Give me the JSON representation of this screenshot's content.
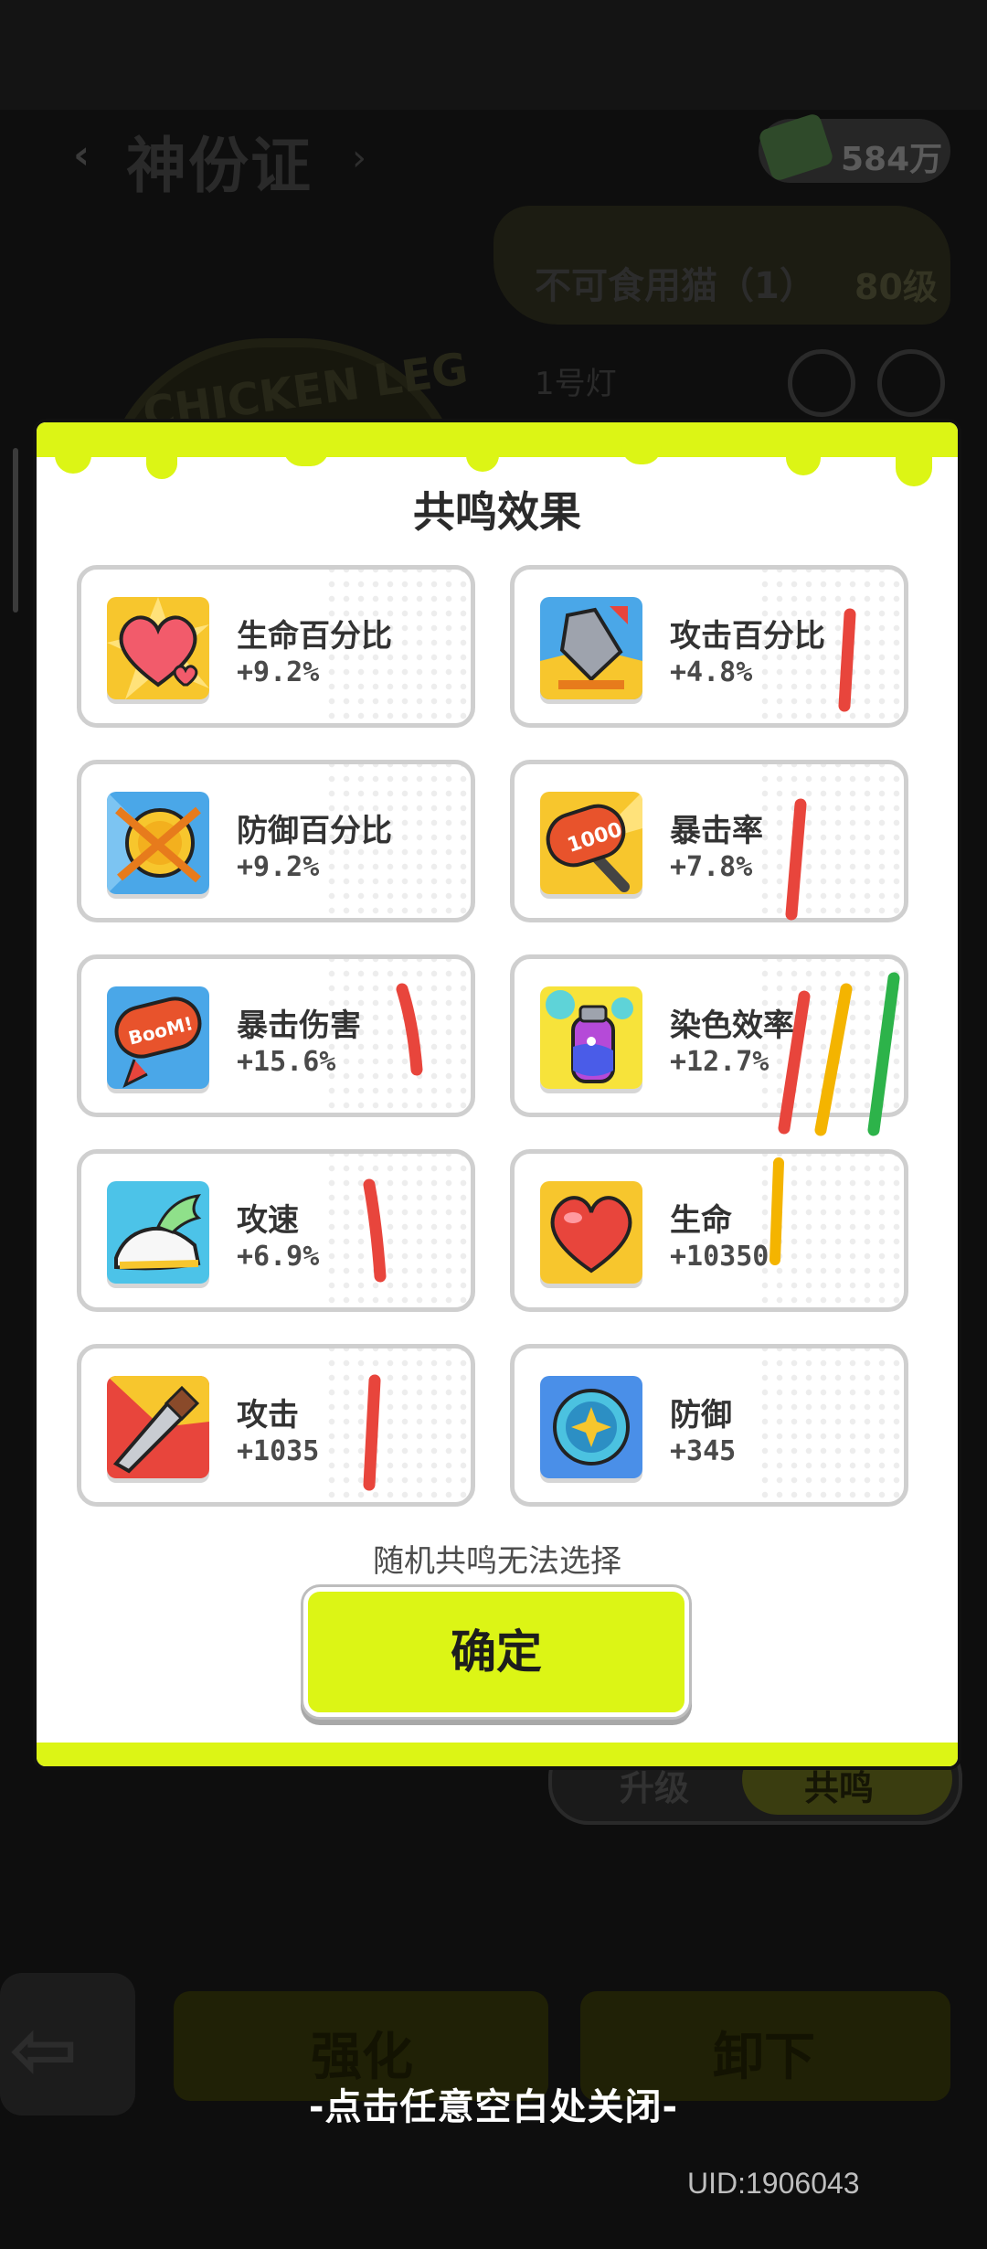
{
  "background": {
    "title": "神份证",
    "currency": "584万",
    "gun_name": "不可食用猫（1）",
    "gun_level": "80级",
    "grade": "1号灯",
    "badge_text": "CHICKEN LEG",
    "tabs": {
      "upgrade": "升级",
      "resonate": "共鸣"
    },
    "buttons": {
      "enhance": "强化",
      "unload": "卸下"
    }
  },
  "modal": {
    "title": "共鸣效果",
    "items": [
      {
        "name": "生命百分比",
        "value": "+9.2%",
        "icon": "heart-percent-icon"
      },
      {
        "name": "攻击百分比",
        "value": "+4.8%",
        "icon": "sword-percent-icon"
      },
      {
        "name": "防御百分比",
        "value": "+9.2%",
        "icon": "shield-coin-icon"
      },
      {
        "name": "暴击率",
        "value": "+7.8%",
        "icon": "hammer-1000-icon"
      },
      {
        "name": "暴击伤害",
        "value": "+15.6%",
        "icon": "boom-hammer-icon"
      },
      {
        "name": "染色效率",
        "value": "+12.7%",
        "icon": "spray-can-icon"
      },
      {
        "name": "攻速",
        "value": "+6.9%",
        "icon": "winged-shoe-icon"
      },
      {
        "name": "生命",
        "value": "+10350",
        "icon": "heart-icon"
      },
      {
        "name": "攻击",
        "value": "+1035",
        "icon": "sword-icon"
      },
      {
        "name": "防御",
        "value": "+345",
        "icon": "star-shield-icon"
      }
    ],
    "note": "随机共鸣无法选择",
    "confirm_label": "确定"
  },
  "close_hint": "-点击任意空白处关闭-",
  "uid": "UID:1906043",
  "colors": {
    "accent": "#dcf515",
    "mark_red": "#e8453c",
    "mark_yellow": "#f4b400",
    "mark_green": "#2db34a"
  }
}
